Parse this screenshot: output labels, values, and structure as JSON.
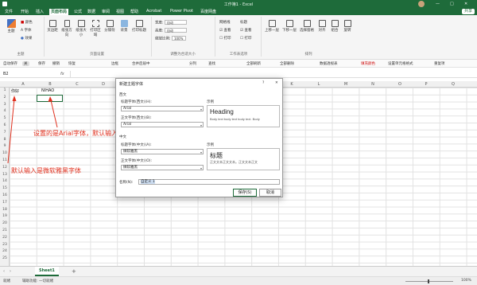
{
  "titlebar": {
    "title": "工作簿1 - Excel",
    "minimize": "—",
    "maximize": "□",
    "close": "✕"
  },
  "menu": [
    "文件",
    "开始",
    "插入",
    "页面布局",
    "公式",
    "数据",
    "审阅",
    "视图",
    "帮助",
    "Acrobat",
    "Power Pivot",
    "百度网盘"
  ],
  "share_label": "共享",
  "ribbon": {
    "theme": {
      "big": "主题",
      "colors": "颜色",
      "fonts": "字体",
      "effects": "效果"
    },
    "page_buttons": [
      "页边距",
      "纸张方向",
      "纸张大小",
      "打印区域",
      "分隔符",
      "背景",
      "打印标题"
    ],
    "scale": {
      "width_label": "宽度:",
      "width_val": "自动",
      "height_label": "高度:",
      "height_val": "自动",
      "scale_label": "缩放比例:",
      "scale_val": "100%"
    },
    "sheet_opts": {
      "grid_title": "网格线",
      "head_title": "标题",
      "view": "查看",
      "print": "打印"
    },
    "arrange": [
      "上移一层",
      "下移一层",
      "选择窗格",
      "对齐",
      "组合",
      "旋转"
    ],
    "groups": [
      "主题",
      "页面设置",
      "调整为合适大小",
      "工作表选项",
      "排列"
    ]
  },
  "qat": [
    "自动保存",
    "关",
    "保存",
    "撤销",
    "恢复",
    "边框",
    "合并后居中",
    "分列",
    "查找",
    "全部刷新",
    "全部删除",
    "数据透视表",
    "填充颜色",
    "设置单元格格式",
    "重复项"
  ],
  "formulabar": {
    "namebox": "B2",
    "fx": "fx"
  },
  "columns": [
    "A",
    "B",
    "C",
    "D",
    "E",
    "F",
    "G",
    "H",
    "I",
    "J",
    "K",
    "L",
    "M",
    "N",
    "O",
    "P",
    "Q"
  ],
  "rows": [
    "1",
    "2",
    "3",
    "4",
    "5",
    "6",
    "7",
    "8",
    "9",
    "10",
    "11",
    "12",
    "13",
    "14",
    "15",
    "16",
    "17",
    "18",
    "19",
    "20",
    "21",
    "22",
    "23",
    "24",
    "25"
  ],
  "cells": {
    "a1": "你好",
    "b1": "NIHAO"
  },
  "annotations": {
    "middle": "设置的是Arial字体，默认输入的还是微软雅黑",
    "left": "默认输入是微软雅黑字体"
  },
  "dialog": {
    "title": "新建主题字体",
    "help": "?",
    "close": "✕",
    "western_section": "西文",
    "heading_western_label": "标题字体(西文)(H):",
    "heading_western_value": "Arial",
    "body_western_label": "正文字体(西文)(B):",
    "body_western_value": "Arial",
    "sample_label": "示例",
    "sample_heading": "Heading",
    "sample_body": "Body text body text body text. Body",
    "asian_section": "中文",
    "heading_asian_label": "标题字体(中文)(A):",
    "heading_asian_value": "微软雅黑",
    "body_asian_label": "正文字体(中文)(O):",
    "body_asian_value": "微软雅黑",
    "sample_heading_cn": "标题",
    "sample_body_cn": "正文文本正文文本。正文文本正文",
    "name_label": "名称(N):",
    "name_value": "自定义 1",
    "save": "保存(S)",
    "cancel": "取消"
  },
  "sheets": {
    "active": "Sheet1",
    "add": "+"
  },
  "status": {
    "ready": "就绪",
    "accessibility": "辅助功能: 一切就绪",
    "zoom": "100%"
  },
  "colors": {
    "brand": "#1e6b3a",
    "annotation": "#e0301e"
  }
}
